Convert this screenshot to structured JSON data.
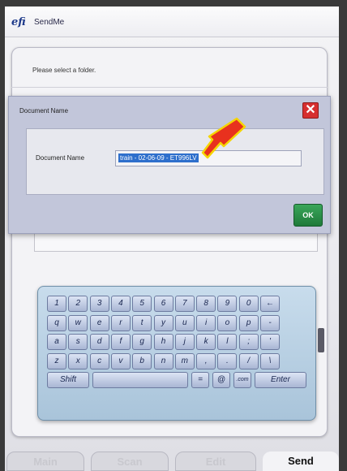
{
  "app": {
    "logo": "efi",
    "title": "SendMe"
  },
  "background": {
    "prompt": "Please select a folder."
  },
  "dialog": {
    "title": "Document Name",
    "close_symbol": "✕",
    "field_label": "Document Name",
    "field_value": "train - 02-06-09 - ET996LV",
    "ok_label": "OK"
  },
  "keyboard": {
    "rows": [
      [
        "1",
        "2",
        "3",
        "4",
        "5",
        "6",
        "7",
        "8",
        "9",
        "0",
        "←"
      ],
      [
        "q",
        "w",
        "e",
        "r",
        "t",
        "y",
        "u",
        "i",
        "o",
        "p",
        "-"
      ],
      [
        "a",
        "s",
        "d",
        "f",
        "g",
        "h",
        "j",
        "k",
        "l",
        ";",
        "'"
      ],
      [
        "z",
        "x",
        "c",
        "v",
        "b",
        "n",
        "m",
        ",",
        ".",
        "/",
        "\\"
      ]
    ],
    "bottom": {
      "shift": "Shift",
      "space": "",
      "equals": "=",
      "at": "@",
      "dotcom": ".com",
      "enter": "Enter"
    }
  },
  "tabs": [
    {
      "label": "Main",
      "active": false
    },
    {
      "label": "Scan",
      "active": false
    },
    {
      "label": "Edit",
      "active": false
    },
    {
      "label": "Send",
      "active": true
    }
  ],
  "colors": {
    "accent_selection": "#2e6fcc",
    "close_red": "#d62f2f",
    "ok_green": "#2a8c48",
    "arrow": "#e8311e"
  }
}
